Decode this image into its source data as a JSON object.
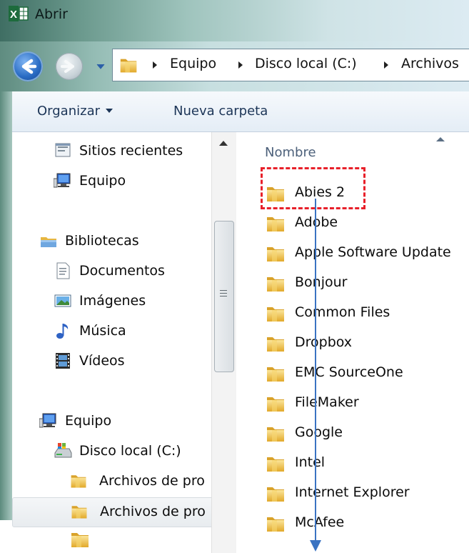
{
  "window": {
    "title": "Abrir",
    "app_icon": "excel-icon"
  },
  "navigation": {
    "back_icon": "back-arrow-icon",
    "forward_icon": "forward-arrow-icon",
    "history_icon": "chevron-down-icon"
  },
  "address_bar": {
    "folder_icon": "folder-icon",
    "breadcrumbs": [
      "Equipo",
      "Disco local (C:)",
      "Archivos"
    ]
  },
  "toolbar": {
    "organize_label": "Organizar",
    "new_folder_label": "Nueva carpeta"
  },
  "nav_pane": {
    "items": [
      {
        "label": "Sitios recientes",
        "icon": "recent-places-icon"
      },
      {
        "label": "Equipo",
        "icon": "computer-icon"
      },
      {
        "label": "Bibliotecas",
        "icon": "libraries-icon"
      },
      {
        "label": "Documentos",
        "icon": "documents-icon"
      },
      {
        "label": "Imágenes",
        "icon": "pictures-icon"
      },
      {
        "label": "Música",
        "icon": "music-icon"
      },
      {
        "label": "Vídeos",
        "icon": "videos-icon"
      },
      {
        "label": "Equipo",
        "icon": "computer-icon"
      },
      {
        "label": "Disco local (C:)",
        "icon": "local-disk-icon"
      },
      {
        "label": "Archivos de pro",
        "icon": "folder-icon"
      },
      {
        "label": "Archivos de pro",
        "icon": "folder-icon",
        "selected": true
      }
    ]
  },
  "content": {
    "column_header": "Nombre",
    "files": [
      "Abies 2",
      "Adobe",
      "Apple Software Update",
      "Bonjour",
      "Common Files",
      "Dropbox",
      "EMC SourceOne",
      "FileMaker",
      "Google",
      "Intel",
      "Internet Explorer",
      "McAfee"
    ],
    "highlighted_file": "Abies 2"
  },
  "colors": {
    "highlight_border": "#e8202a",
    "arrow": "#3a73c2",
    "folder": "#e8b93c"
  }
}
